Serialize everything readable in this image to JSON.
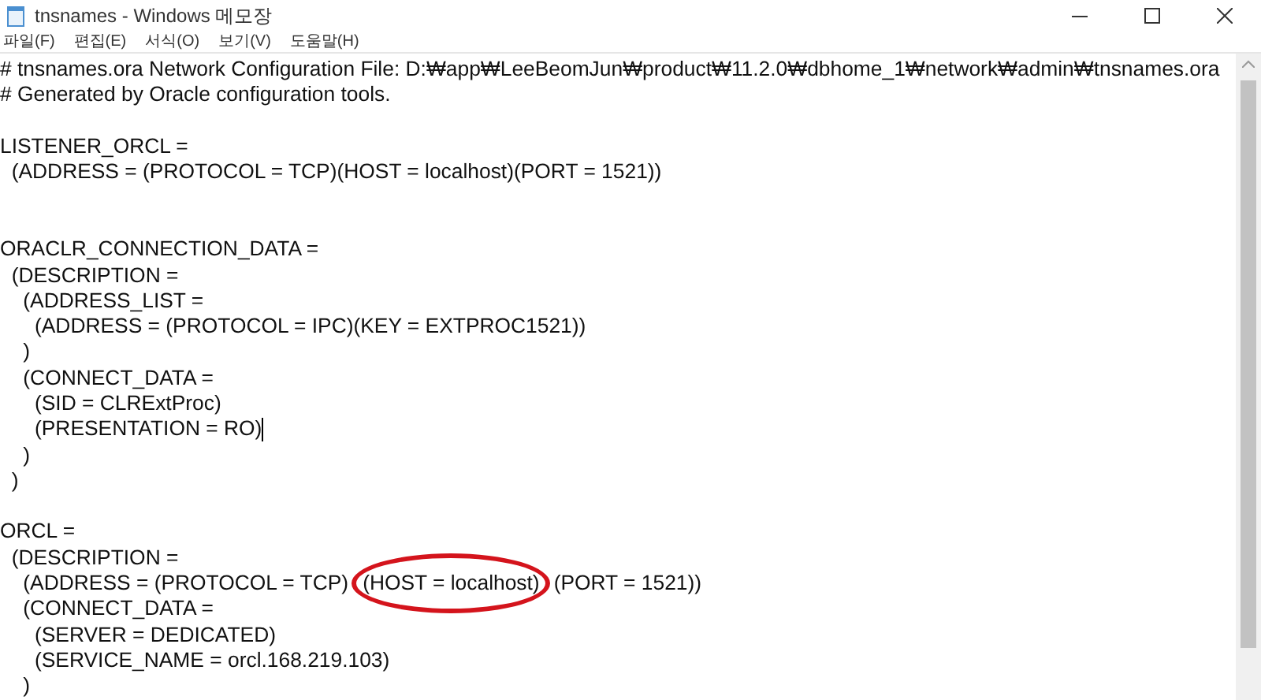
{
  "window": {
    "title": "tnsnames - Windows 메모장"
  },
  "menu": [
    {
      "label": "파일(F)"
    },
    {
      "label": "편집(E)"
    },
    {
      "label": "서식(O)"
    },
    {
      "label": "보기(V)"
    },
    {
      "label": "도움말(H)"
    }
  ],
  "editor": {
    "lines": [
      {
        "kind": "text",
        "text": "# tnsnames.ora Network Configuration File: D:₩app₩LeeBeomJun₩product₩11.2.0₩dbhome_1₩network₩admin₩tnsnames.ora"
      },
      {
        "kind": "text",
        "text": "# Generated by Oracle configuration tools."
      },
      {
        "kind": "blank"
      },
      {
        "kind": "text",
        "text": "LISTENER_ORCL ="
      },
      {
        "kind": "text",
        "text": "  (ADDRESS = (PROTOCOL = TCP)(HOST = localhost)(PORT = 1521))"
      },
      {
        "kind": "blank"
      },
      {
        "kind": "blank"
      },
      {
        "kind": "text",
        "text": "ORACLR_CONNECTION_DATA ="
      },
      {
        "kind": "text",
        "text": "  (DESCRIPTION ="
      },
      {
        "kind": "text",
        "text": "    (ADDRESS_LIST ="
      },
      {
        "kind": "text",
        "text": "      (ADDRESS = (PROTOCOL = IPC)(KEY = EXTPROC1521))"
      },
      {
        "kind": "text",
        "text": "    )"
      },
      {
        "kind": "text",
        "text": "    (CONNECT_DATA ="
      },
      {
        "kind": "text",
        "text": "      (SID = CLRExtProc)"
      },
      {
        "kind": "text",
        "text": "      (PRESENTATION = RO)",
        "cursor": true
      },
      {
        "kind": "text",
        "text": "    )"
      },
      {
        "kind": "text",
        "text": "  )"
      },
      {
        "kind": "blank"
      },
      {
        "kind": "text",
        "text": "ORCL ="
      },
      {
        "kind": "text",
        "text": "  (DESCRIPTION ="
      },
      {
        "kind": "segments",
        "segments": [
          {
            "text": "    (ADDRESS = (PROTOCOL = TCP)",
            "circled": false
          },
          {
            "text": "(HOST = localhost)",
            "circled": true
          },
          {
            "text": "(PORT = 1521))",
            "circled": false
          }
        ]
      },
      {
        "kind": "text",
        "text": "    (CONNECT_DATA ="
      },
      {
        "kind": "text",
        "text": "      (SERVER = DEDICATED)"
      },
      {
        "kind": "text",
        "text": "      (SERVICE_NAME = orcl.168.219.103)"
      },
      {
        "kind": "text",
        "text": "    )"
      }
    ]
  }
}
